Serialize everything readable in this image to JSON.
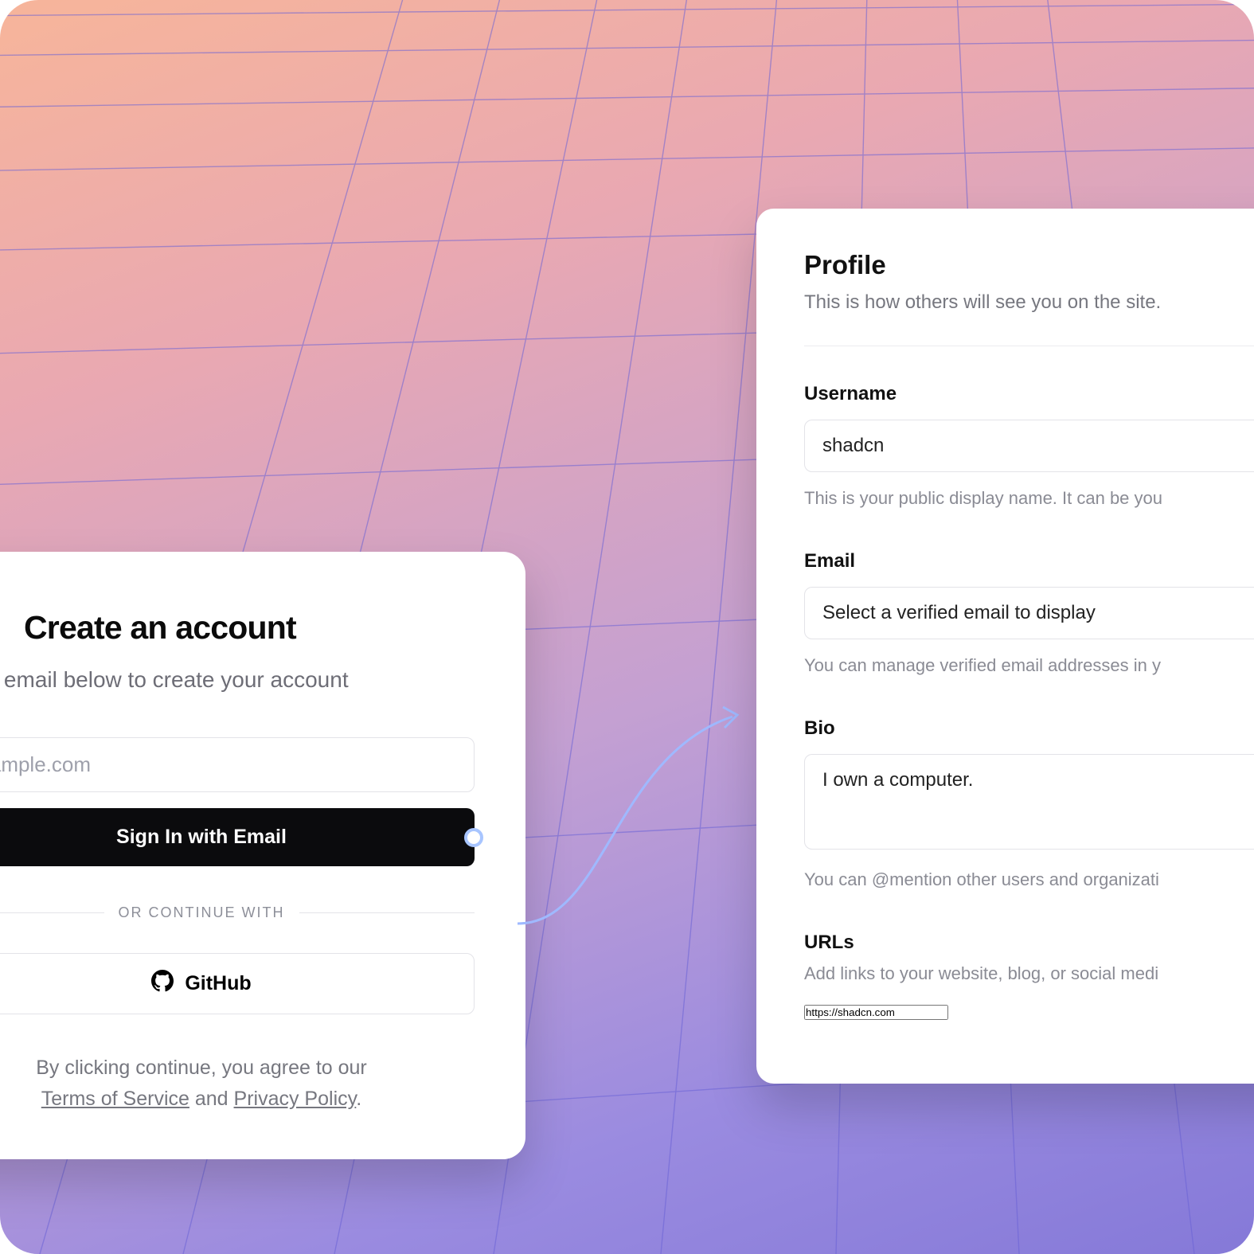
{
  "signup": {
    "title": "Create an account",
    "subtitle": "er your email below to create your account",
    "email_placeholder": "@example.com",
    "submit_label": "Sign In with Email",
    "divider_label": "OR CONTINUE WITH",
    "github_label": "GitHub",
    "legal_prefix": "By clicking continue, you agree to our",
    "terms_label": "Terms of Service",
    "legal_middle": " and ",
    "privacy_label": "Privacy Policy",
    "legal_suffix": "."
  },
  "profile": {
    "heading": "Profile",
    "description": "This is how others will see you on the site.",
    "username_label": "Username",
    "username_value": "shadcn",
    "username_hint": "This is your public display name. It can be you",
    "email_label": "Email",
    "email_select_placeholder": "Select a verified email to display",
    "email_hint": "You can manage verified email addresses in y",
    "bio_label": "Bio",
    "bio_value": "I own a computer.",
    "bio_hint": "You can @mention other users and organizati",
    "urls_label": "URLs",
    "urls_hint": "Add links to your website, blog, or social medi",
    "urls_value": "https://shadcn.com"
  }
}
